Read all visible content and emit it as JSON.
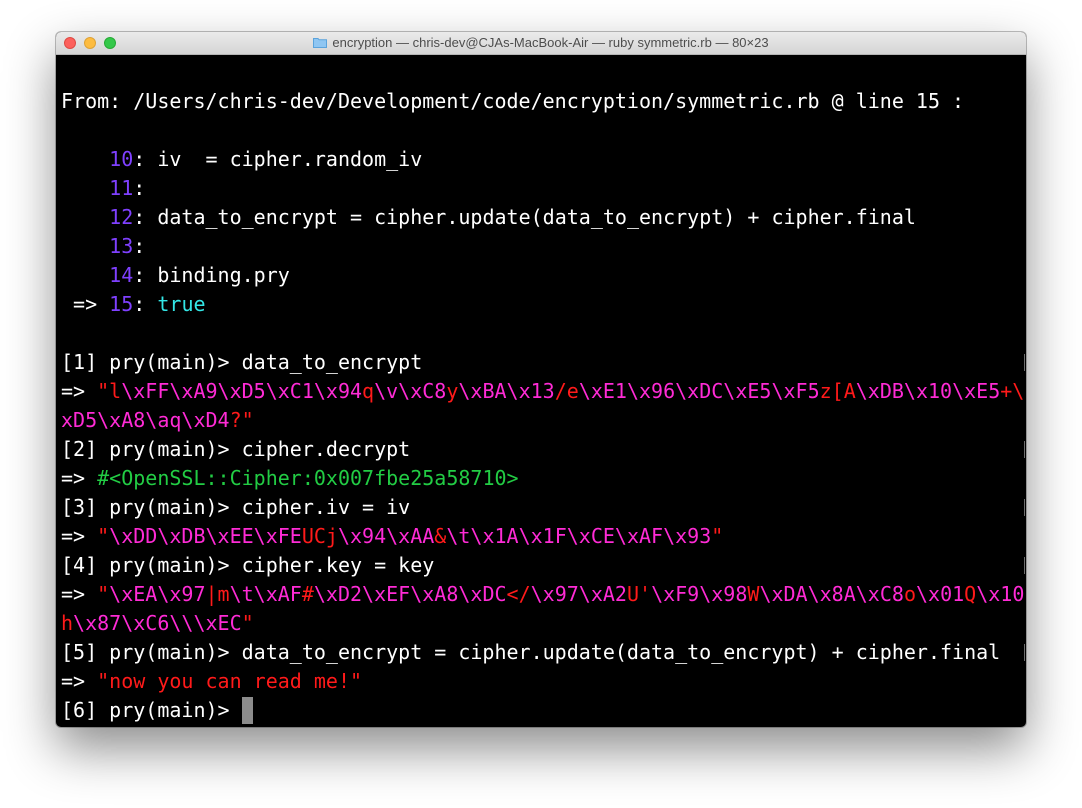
{
  "window": {
    "title": "encryption — chris-dev@CJAs-MacBook-Air — ruby symmetric.rb — 80×23"
  },
  "terminal": {
    "from_line": "From: /Users/chris-dev/Development/code/encryption/symmetric.rb @ line 15 :",
    "code": [
      {
        "num": "10",
        "text": ": iv  = cipher.random_iv"
      },
      {
        "num": "11",
        "text": ":"
      },
      {
        "num": "12",
        "text": ": data_to_encrypt = cipher.update(data_to_encrypt) + cipher.final"
      },
      {
        "num": "13",
        "text": ":"
      },
      {
        "num": "14",
        "text": ": binding.pry"
      },
      {
        "arrow": " => ",
        "num": "15",
        "sep": ": ",
        "value": "true"
      }
    ],
    "prompts": [
      "[1] pry(main)> data_to_encrypt",
      "[2] pry(main)> cipher.decrypt",
      "[3] pry(main)> cipher.iv = iv",
      "[4] pry(main)> cipher.key = key",
      "[5] pry(main)> data_to_encrypt = cipher.update(data_to_encrypt) + cipher.final",
      "[6] pry(main)> "
    ],
    "result_arrow": "=> ",
    "r1": {
      "a": "\"",
      "b": "l",
      "c": "\\xFF\\xA9\\xD5\\xC1\\x94",
      "d": "q",
      "e": "\\v\\xC8",
      "f": "y",
      "g": "\\xBA\\x13",
      "h": "/e",
      "i": "\\xE1\\x96\\xDC\\xE5\\xF5",
      "j": "z[A",
      "k": "\\xDB\\x10\\xE5",
      "l": "+\\",
      "m": "xD5\\xA8\\aq\\xD4",
      "n": "?\""
    },
    "r2": "#<OpenSSL::Cipher:0x007fbe25a58710>",
    "r3": {
      "a": "\"",
      "b": "\\xDD\\xDB\\xEE\\xFE",
      "c": "UCj",
      "d": "\\x94\\xAA",
      "e": "&",
      "f": "\\t\\x1A\\x1F\\xCE\\xAF\\x93",
      "g": "\""
    },
    "r4": {
      "a": "\"",
      "b": "\\xEA\\x97",
      "c": "|m",
      "d": "\\t\\xAF",
      "e": "#",
      "f": "\\xD2\\xEF\\xA8\\xDC",
      "g": "</",
      "h": "\\x97\\xA2",
      "i": "U'",
      "j": "\\xF9\\x98",
      "k": "W",
      "l": "\\xDA\\x8A\\xC8",
      "m": "o",
      "n": "\\x01",
      "o": "Q",
      "p": "\\x10",
      "q": "h",
      "r": "\\x87\\xC6\\\\\\xEC",
      "s": "\""
    },
    "r5": "\"now you can read me!\""
  },
  "colors": {
    "background": "#000000",
    "text": "#ffffff",
    "line_number": "#7f40ff",
    "boolean": "#33e6e6",
    "escape": "#ff2bd6",
    "string": "#ff1a1a",
    "object": "#22cc44",
    "cursor": "#8c8c8c"
  }
}
